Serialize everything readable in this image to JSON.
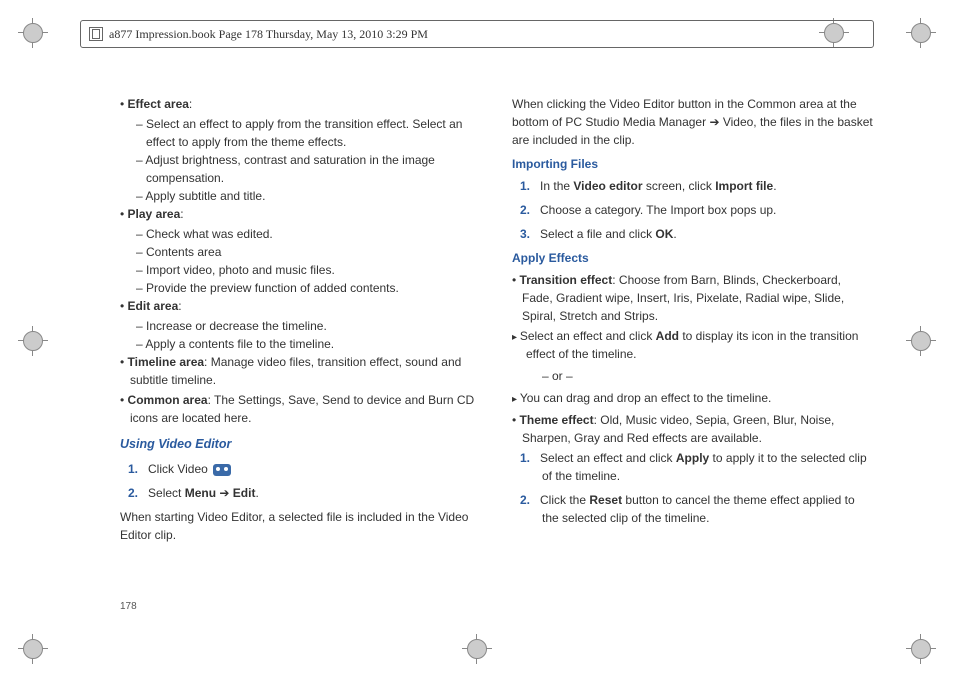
{
  "header": "a877 Impression.book  Page 178  Thursday, May 13, 2010  3:29 PM",
  "page_number": "178",
  "left": {
    "effect_area_label": "Effect area",
    "effect_area_items": [
      "Select an effect to apply from the transition effect. Select an effect to apply from the theme effects.",
      "Adjust brightness, contrast and saturation in the image compensation.",
      "Apply subtitle and title."
    ],
    "play_area_label": "Play area",
    "play_area_items": [
      "Check what was edited.",
      "Contents area",
      "Import video, photo and music files.",
      "Provide the preview function of added contents."
    ],
    "edit_area_label": "Edit area",
    "edit_area_items": [
      "Increase or decrease the timeline.",
      "Apply a contents file to the timeline."
    ],
    "timeline_label": "Timeline area",
    "timeline_text": ": Manage video files, transition effect, sound and subtitle timeline.",
    "common_label": "Common area",
    "common_text": ": The Settings, Save, Send to device and Burn CD icons are located here.",
    "using_video_editor": "Using Video Editor",
    "step1_pre": "Click Video ",
    "step2_pre": "Select ",
    "step2_b1": "Menu",
    "step2_arrow": " ➔ ",
    "step2_b2": "Edit",
    "step2_post": ".",
    "para": "When starting Video Editor, a selected file is included in the Video Editor clip."
  },
  "right": {
    "intro": "When clicking the Video Editor button in the Common area at the bottom of PC Studio Media Manager  ➔ Video, the files in the basket are included in the clip.",
    "importing_files": "Importing Files",
    "imp1_pre": "In the ",
    "imp1_b1": "Video editor",
    "imp1_mid": " screen, click ",
    "imp1_b2": "Import file",
    "imp1_post": ".",
    "imp2": "Choose a category. The Import box pops up.",
    "imp3_pre": "Select a file and click ",
    "imp3_b": "OK",
    "imp3_post": ".",
    "apply_effects": "Apply Effects",
    "transition_label": "Transition effect",
    "transition_text": ": Choose from Barn, Blinds, Checkerboard, Fade, Gradient wipe, Insert, Iris, Pixelate, Radial wipe, Slide, Spiral, Stretch and Strips.",
    "arrow1_pre": "Select an effect and click ",
    "arrow1_b": "Add",
    "arrow1_post": " to display its icon in the transition effect of the timeline.",
    "or": "– or –",
    "arrow2": "You can drag and drop an effect to the timeline.",
    "theme_label": "Theme effect",
    "theme_text": ": Old, Music video, Sepia, Green, Blur, Noise, Sharpen, Gray and Red effects are available.",
    "th1_pre": "Select an effect and click ",
    "th1_b": "Apply",
    "th1_post": " to apply it to the selected clip of the timeline.",
    "th2_pre": "Click the ",
    "th2_b": "Reset",
    "th2_post": " button to cancel the theme effect applied to the selected clip of the timeline."
  }
}
